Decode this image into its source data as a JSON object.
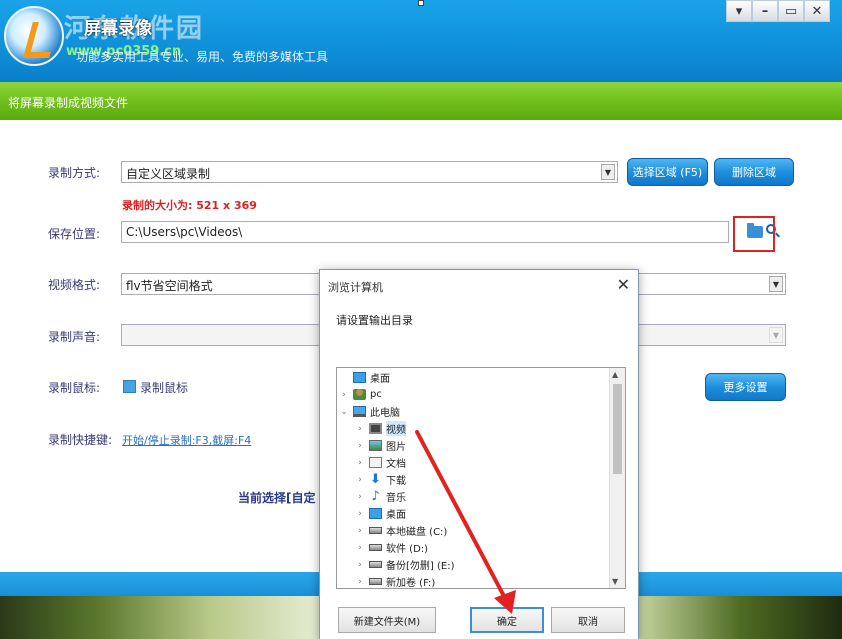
{
  "header": {
    "app_title": "屏幕录像",
    "subtitle": "功能多实用工具专业、易用、免费的多媒体工具",
    "watermark": "河东软件园",
    "watermark_url": "www.pc0359.cn",
    "win_buttons": [
      "▾",
      "–",
      "▭",
      "✕"
    ]
  },
  "greenbar": {
    "title": "将屏幕录制成视频文件"
  },
  "form": {
    "record_mode_label": "录制方式:",
    "record_mode_value": "自定义区域录制",
    "select_area_button": "选择区域 (F5)",
    "delete_area_button": "删除区域",
    "record_size_text": "录制的大小为: 521 x 369",
    "save_location_label": "保存位置:",
    "save_location_value": "C:\\Users\\pc\\Videos\\",
    "video_format_label": "视频格式:",
    "video_format_value": "flv节省空间格式",
    "audio_label": "录制声音:",
    "audio_value": "",
    "mouse_label": "录制鼠标:",
    "mouse_checkbox_label": "录制鼠标",
    "more_settings_button": "更多设置",
    "hotkey_label": "录制快捷键:",
    "hotkey_value": "开始/停止录制:F3,截屏:F4",
    "current_selection": "当前选择[自定"
  },
  "dialog": {
    "title": "浏览计算机",
    "prompt": "请设置输出目录",
    "tree": [
      {
        "label": "桌面",
        "icon": "desktop-icon",
        "chev": ""
      },
      {
        "label": "pc",
        "icon": "user-icon",
        "chev": "›"
      },
      {
        "label": "此电脑",
        "icon": "pc-icon",
        "chev": "⌄"
      },
      {
        "label": "视频",
        "icon": "video-icon",
        "chev": "›",
        "selected": true
      },
      {
        "label": "图片",
        "icon": "picture-icon",
        "chev": "›"
      },
      {
        "label": "文档",
        "icon": "document-icon",
        "chev": "›"
      },
      {
        "label": "下载",
        "icon": "download-icon",
        "chev": "›"
      },
      {
        "label": "音乐",
        "icon": "music-icon",
        "chev": "›"
      },
      {
        "label": "桌面",
        "icon": "desktop-icon",
        "chev": "›"
      },
      {
        "label": "本地磁盘 (C:)",
        "icon": "disk-icon",
        "chev": "›"
      },
      {
        "label": "软件 (D:)",
        "icon": "disk-icon",
        "chev": "›"
      },
      {
        "label": "备份[勿删] (E:)",
        "icon": "disk-icon",
        "chev": "›"
      },
      {
        "label": "新加卷 (F:)",
        "icon": "disk-icon",
        "chev": "›"
      }
    ],
    "new_folder_button": "新建文件夹(M)",
    "ok_button": "确定",
    "cancel_button": "取消"
  },
  "colors": {
    "accent_blue": "#1a8fd8",
    "green_bar": "#6fbe1a",
    "highlight_red": "#e52020"
  }
}
